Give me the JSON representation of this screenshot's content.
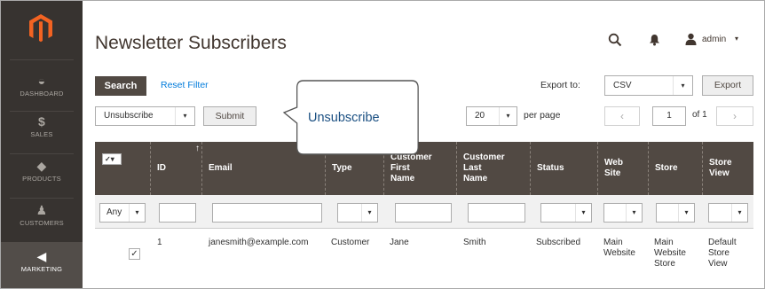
{
  "sidebar": {
    "logo": "magento-logo-icon",
    "items": [
      {
        "label": "DASHBOARD",
        "icon": "dashboard-icon",
        "glyph": "◒",
        "active": false
      },
      {
        "label": "SALES",
        "icon": "dollar-icon",
        "glyph": "$",
        "active": false
      },
      {
        "label": "PRODUCTS",
        "icon": "cube-icon",
        "glyph": "◆",
        "active": false
      },
      {
        "label": "CUSTOMERS",
        "icon": "person-icon",
        "glyph": "♟",
        "active": false
      },
      {
        "label": "MARKETING",
        "icon": "megaphone-icon",
        "glyph": "◀",
        "active": true
      }
    ]
  },
  "header": {
    "title": "Newsletter Subscribers",
    "user": "admin",
    "caret": "▾"
  },
  "toolbar": {
    "search_label": "Search",
    "reset_label": "Reset Filter",
    "export_to_label": "Export to:",
    "export_format": "CSV",
    "export_label": "Export",
    "action_value": "Unsubscribe",
    "submit_label": "Submit",
    "per_page_value": "20",
    "per_page_label": "per page",
    "page_current": "1",
    "page_of": "of 1",
    "prev_glyph": "‹",
    "next_glyph": "›",
    "arrow_glyph": "▾"
  },
  "grid": {
    "mass_action_glyph": "✓▾",
    "sort_glyph": "↑",
    "columns": [
      "ID",
      "Email",
      "Type",
      "Customer First Name",
      "Customer Last Name",
      "Status",
      "Web Site",
      "Store",
      "Store View"
    ],
    "columns_display": {
      "first_name_line1": "Customer",
      "first_name_line2": "First",
      "first_name_line3": "Name",
      "last_name_line1": "Customer",
      "last_name_line2": "Last",
      "last_name_line3": "Name",
      "website_line1": "Web",
      "website_line2": "Site",
      "storeview_line1": "Store",
      "storeview_line2": "View"
    },
    "filter_any": "Any",
    "rows": [
      {
        "checked": "✓",
        "id": "1",
        "email": "janesmith@example.com",
        "type": "Customer",
        "first_name": "Jane",
        "last_name": "Smith",
        "status": "Subscribed",
        "website_line1": "Main",
        "website_line2": "Website",
        "store_line1": "Main",
        "store_line2": "Website",
        "store_line3": "Store",
        "storeview_line1": "Default",
        "storeview_line2": "Store",
        "storeview_line3": "View"
      }
    ]
  },
  "callout": {
    "text": "Unsubscribe"
  },
  "colors": {
    "sidebar_bg": "#373330",
    "header_bg": "#514943",
    "link": "#007bdb",
    "logo": "#f26322",
    "callout_text": "#1a4f82"
  }
}
